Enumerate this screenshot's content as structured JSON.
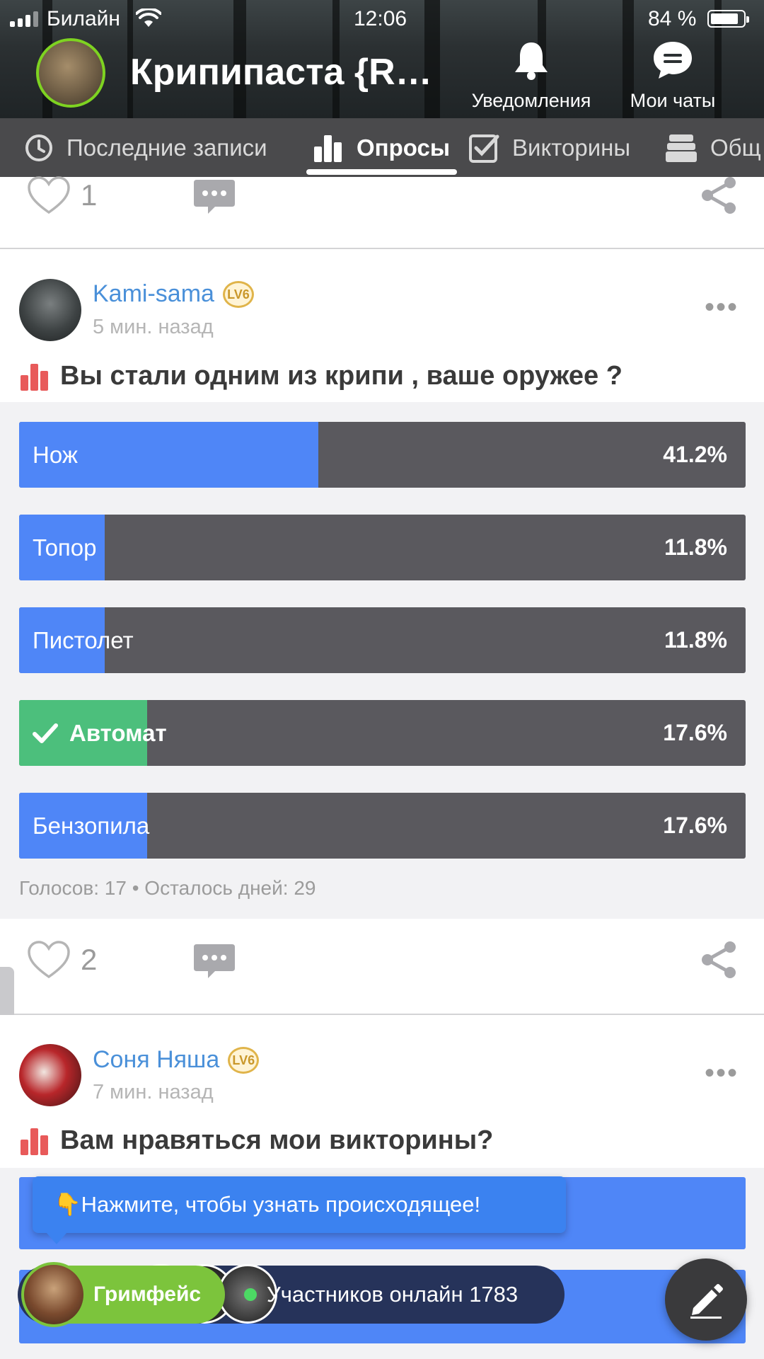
{
  "status_bar": {
    "carrier": "Билайн",
    "time": "12:06",
    "battery": "84 %"
  },
  "header": {
    "community_title": "Крипипаста {R…",
    "notifications_label": "Уведомления",
    "chats_label": "Мои чаты"
  },
  "tabs": [
    {
      "label": "Последние записи",
      "icon": "clock-icon"
    },
    {
      "label": "Опросы",
      "icon": "bar-chart-icon",
      "active": true
    },
    {
      "label": "Викторины",
      "icon": "checkbox-icon"
    },
    {
      "label": "Общ",
      "icon": "stack-icon"
    }
  ],
  "prev_post": {
    "likes": "1"
  },
  "post1": {
    "author": "Kami-sama",
    "level": "LV6",
    "time_ago": "5 мин. назад",
    "title": "Вы стали одним из крипи , ваше оружее ?",
    "options": [
      {
        "label": "Нож",
        "percent": "41.2%",
        "fill": 0.412
      },
      {
        "label": "Топор",
        "percent": "11.8%",
        "fill": 0.118
      },
      {
        "label": "Пистолет",
        "percent": "11.8%",
        "fill": 0.118
      },
      {
        "label": "Автомат",
        "percent": "17.6%",
        "fill": 0.176,
        "voted": true
      },
      {
        "label": "Бензопила",
        "percent": "17.6%",
        "fill": 0.176
      }
    ],
    "meta": "Голосов: 17 • Осталось дней: 29",
    "likes": "2"
  },
  "post2": {
    "author": "Соня Няша",
    "level": "LV6",
    "time_ago": "7 мин. назад",
    "title": "Вам нравяться мои викторины?"
  },
  "tooltip": {
    "text": "👇Нажмите, чтобы узнать происходящее!"
  },
  "online": {
    "featured_name": "Гримфейс",
    "count_text": "Участников онлайн 1783"
  },
  "colors": {
    "poll_fill": "#4f86f7",
    "poll_voted": "#4cbf7c",
    "poll_track": "#5a595e",
    "author_link": "#4a90d9",
    "online_green": "#7cc43c"
  }
}
